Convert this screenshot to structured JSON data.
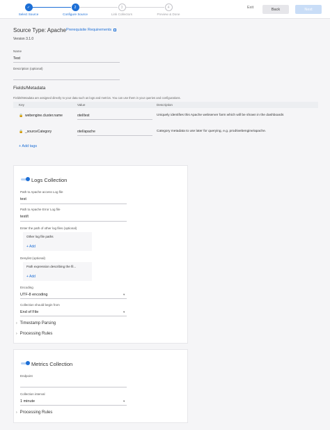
{
  "header": {
    "steps": [
      {
        "num": "✓",
        "label": "Select Source",
        "state": "done"
      },
      {
        "num": "2",
        "label": "Configure Source",
        "state": "active"
      },
      {
        "num": "3",
        "label": "Link Collectors",
        "state": "todo"
      },
      {
        "num": "4",
        "label": "Preview & Done",
        "state": "todo"
      }
    ],
    "exit_label": "Exit",
    "back_label": "Back",
    "next_label": "Next"
  },
  "source": {
    "title": "Source Type: Apache",
    "prereq_label": "Prerequisite Requirements",
    "version": "Version 3.1.0"
  },
  "form": {
    "name_label": "Name",
    "name_value": "Test",
    "description_label": "Description (optional)",
    "description_value": ""
  },
  "fields": {
    "title": "Fields/Metadata",
    "description": "Fields/Metadata are assigned directly to your data such as logs and metrics. You can use them in your queries and configurations.",
    "columns": [
      "Key",
      "Value",
      "Description"
    ],
    "rows": [
      {
        "key": "webengine.cluster.name",
        "value": "otel/test",
        "description": "Uniquely identifies this Apache webserver farm which will be shown in the dashboards"
      },
      {
        "key": "_sourceCategory",
        "value": "otel/apache",
        "description": "Category metadata to use later for querying, e.g. prod/webengine/apache."
      }
    ],
    "add_tags_label": "+ Add tags"
  },
  "logs": {
    "title": "Logs Collection",
    "access_label": "Path to Apache access Log file",
    "access_value": "test",
    "error_label": "Path to Apache Error Log file",
    "error_value": "test/t",
    "other_label": "Enter the path of other log files (optional)",
    "other_header": "Other log file paths",
    "other_add": "+ Add",
    "denylist_label": "Denylist (optional)",
    "denylist_header": "Path expression describing the fil...",
    "denylist_add": "+ Add",
    "encoding_label": "Encoding",
    "encoding_value": "UTF-8 encoding",
    "begin_label": "Collection should begin from",
    "begin_value": "End of File",
    "timestamp_label": "Timestamp Parsing",
    "processing_label": "Processing Rules"
  },
  "metrics": {
    "title": "Metrics Collection",
    "endpoint_label": "Endpoint",
    "endpoint_value": "",
    "interval_label": "Collection interval",
    "interval_value": "1 minute",
    "processing_label": "Processing Rules"
  }
}
